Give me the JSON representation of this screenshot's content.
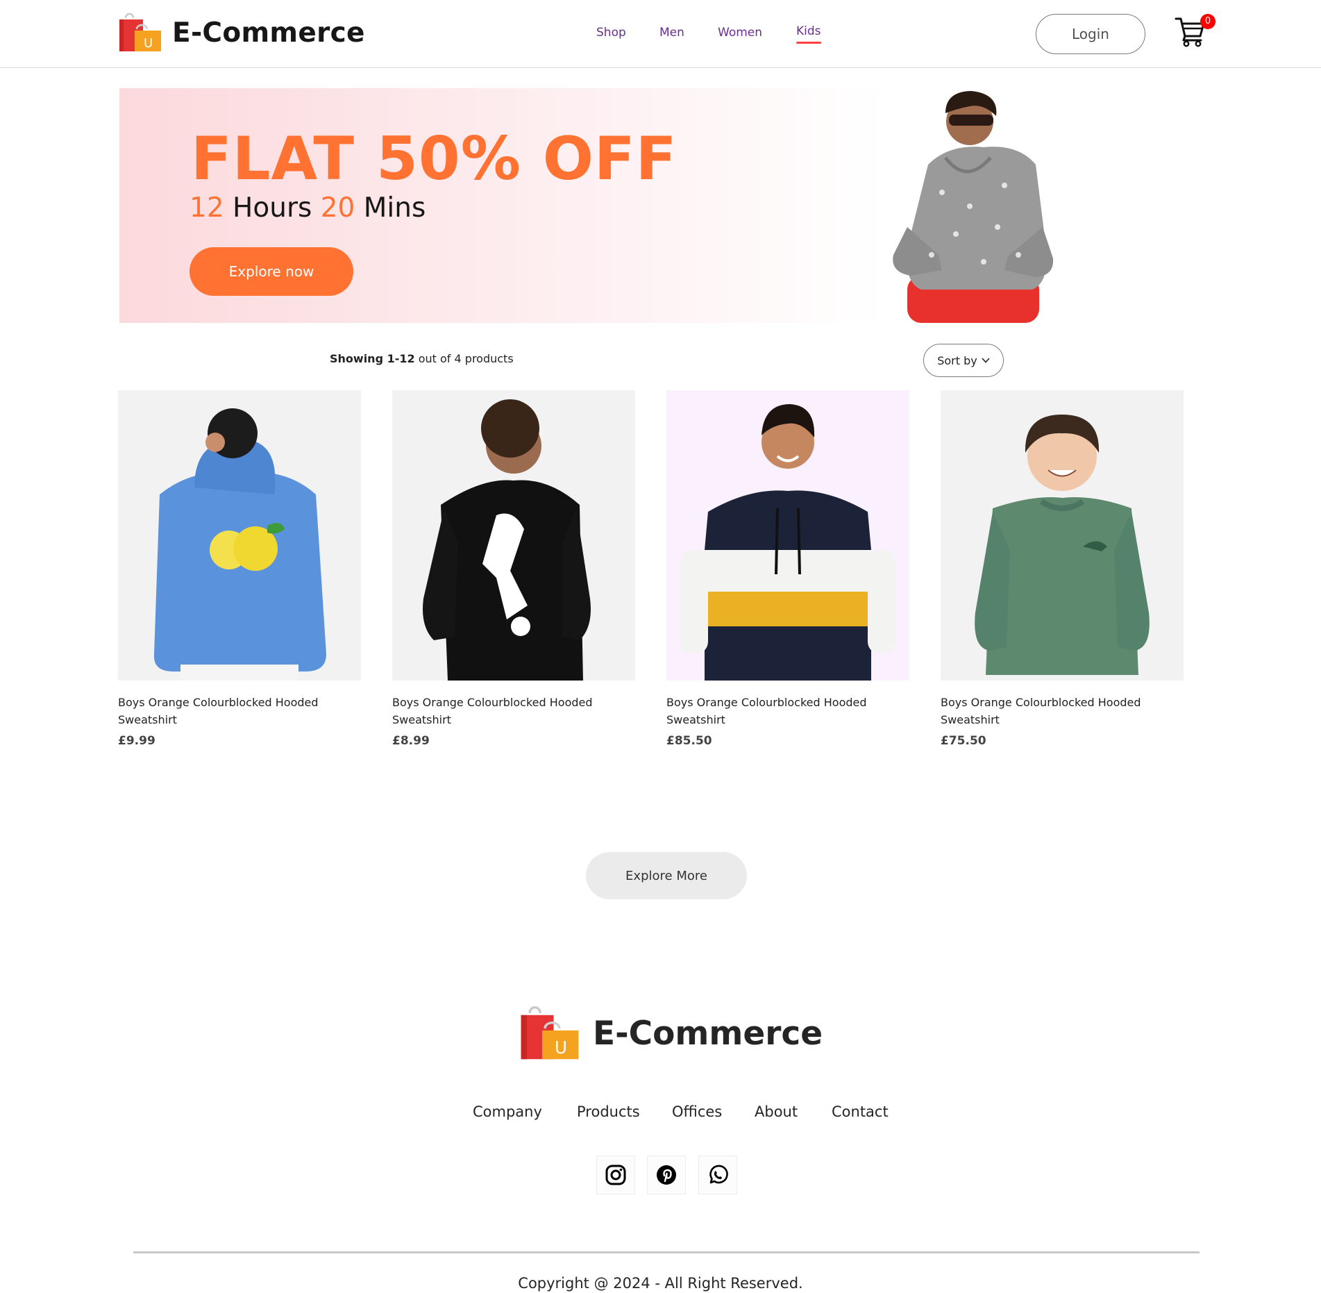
{
  "brand": {
    "name": "E-Commerce",
    "bag_letter": "U"
  },
  "nav": {
    "items": [
      {
        "label": "Shop",
        "active": false
      },
      {
        "label": "Men",
        "active": false
      },
      {
        "label": "Women",
        "active": false
      },
      {
        "label": "Kids",
        "active": true
      }
    ]
  },
  "header": {
    "login_label": "Login",
    "cart_count": "0"
  },
  "hero": {
    "headline": "FLAT 50% OFF",
    "timer": {
      "hours": "12",
      "hours_label": "Hours",
      "mins": "20",
      "mins_label": "Mins"
    },
    "button_label": "Explore now"
  },
  "listing": {
    "showing_bold": "Showing 1-12",
    "showing_rest": "out of 4 products",
    "sort_label": "Sort by"
  },
  "products": [
    {
      "title": "Boys Orange Colourblocked Hooded Sweatshirt",
      "price": "£9.99"
    },
    {
      "title": "Boys Orange Colourblocked Hooded Sweatshirt",
      "price": "£8.99"
    },
    {
      "title": "Boys Orange Colourblocked Hooded Sweatshirt",
      "price": "£85.50"
    },
    {
      "title": "Boys Orange Colourblocked Hooded Sweatshirt",
      "price": "£75.50"
    }
  ],
  "explore_more_label": "Explore More",
  "footer": {
    "links": [
      "Company",
      "Products",
      "Offices",
      "About",
      "Contact"
    ],
    "social": [
      "instagram-icon",
      "pinterest-icon",
      "whatsapp-icon"
    ],
    "copyright": "Copyright @ 2024 - All Right Reserved."
  },
  "colors": {
    "accent": "#ff7231",
    "nav_text": "#6a2d8f",
    "active_underline": "#ff4141",
    "cart_badge": "#ff0000"
  }
}
